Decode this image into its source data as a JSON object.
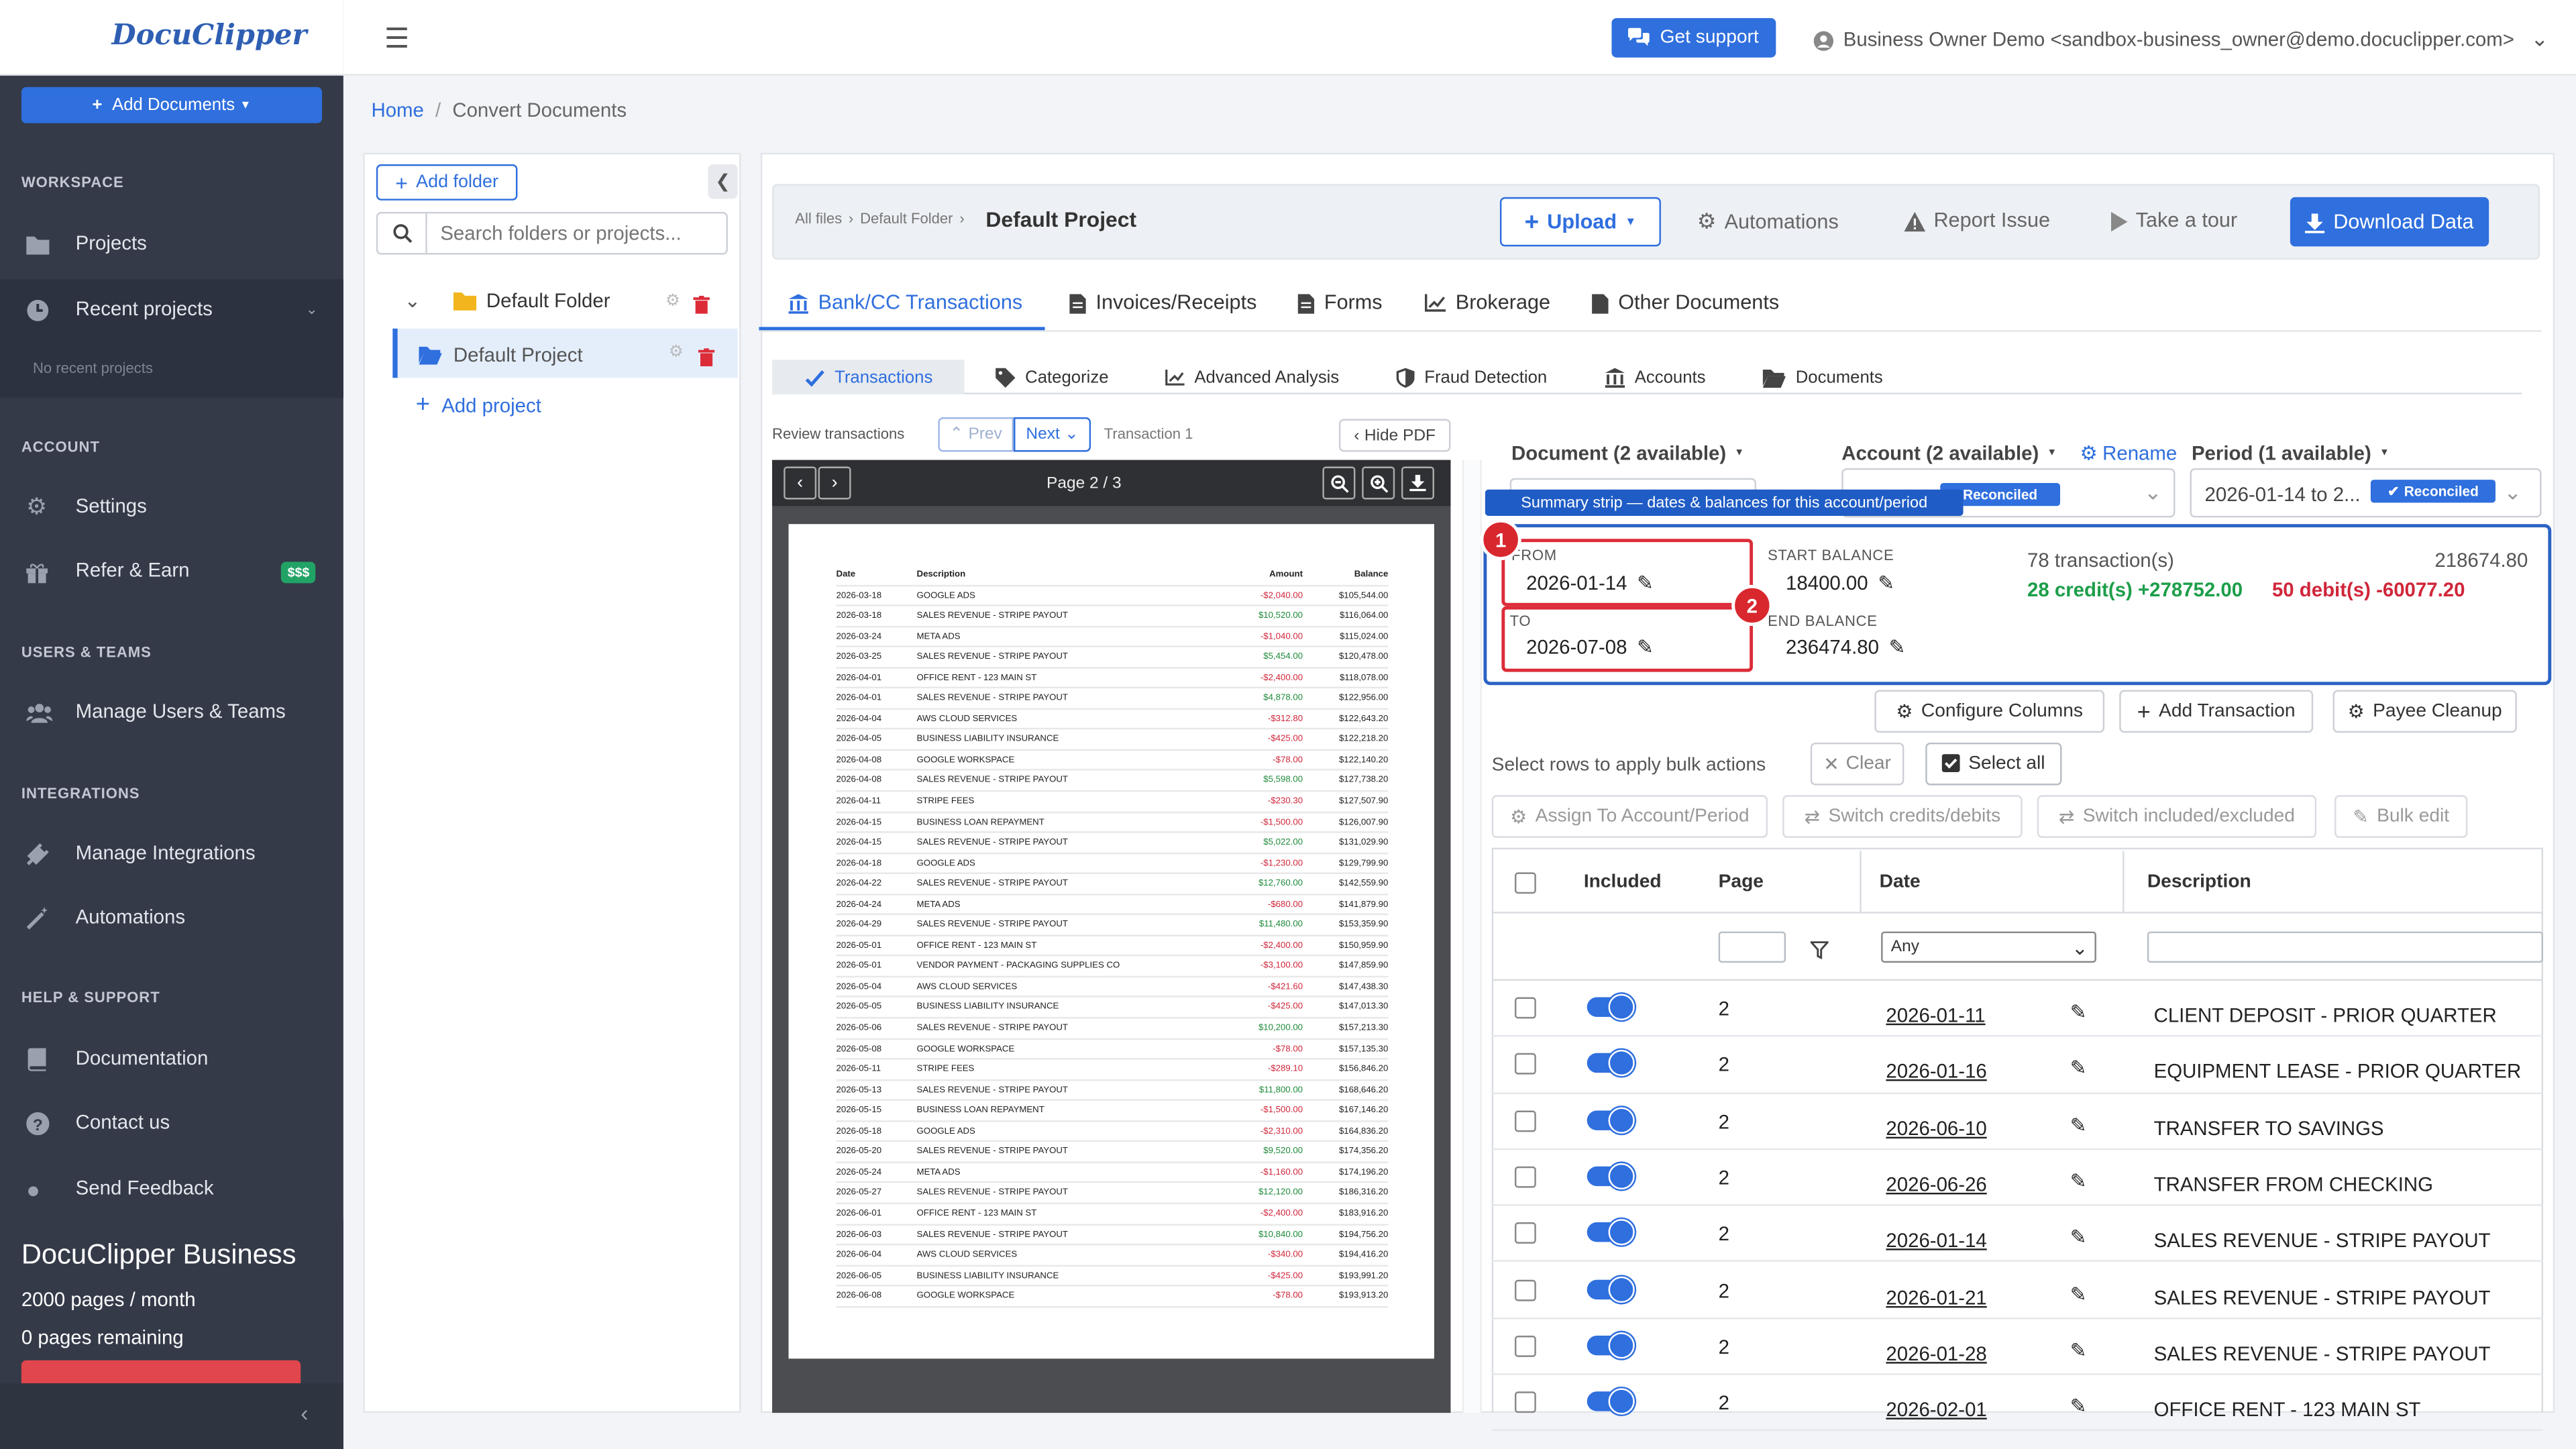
{
  "app": {
    "logo": "DocuClipper"
  },
  "sidebar": {
    "add_documents": "Add Documents",
    "sections": {
      "workspace": "WORKSPACE",
      "account": "ACCOUNT",
      "users_teams": "USERS & TEAMS",
      "integrations": "INTEGRATIONS",
      "help": "HELP & SUPPORT"
    },
    "items": {
      "projects": "Projects",
      "recent_projects": "Recent projects",
      "no_recent": "No recent projects",
      "settings": "Settings",
      "refer": "Refer & Earn",
      "refer_badge": "$$$",
      "manage_users": "Manage Users & Teams",
      "manage_integrations": "Manage Integrations",
      "automations": "Automations",
      "documentation": "Documentation",
      "contact": "Contact us",
      "send_feedback": "Send Feedback"
    },
    "plan": {
      "title": "DocuClipper Business",
      "pages": "2000 pages / month",
      "remaining": "0 pages remaining"
    }
  },
  "topbar": {
    "support": "Get support",
    "user": "Business Owner Demo <sandbox-business_owner@demo.docuclipper.com>"
  },
  "breadcrumb": {
    "home": "Home",
    "sep": "/",
    "current": "Convert Documents"
  },
  "folders": {
    "add_folder": "Add folder",
    "search_placeholder": "Search folders or projects...",
    "default_folder": "Default Folder",
    "default_project": "Default Project",
    "add_project": "Add project"
  },
  "header": {
    "crumb_all": "All files",
    "crumb_folder": "Default Folder",
    "title": "Default Project",
    "upload": "Upload",
    "automations": "Automations",
    "report": "Report Issue",
    "tour": "Take a tour",
    "download": "Download Data"
  },
  "tabs": [
    "Bank/CC Transactions",
    "Invoices/Receipts",
    "Forms",
    "Brokerage",
    "Other Documents"
  ],
  "subtabs": [
    "Transactions",
    "Categorize",
    "Advanced Analysis",
    "Fraud Detection",
    "Accounts",
    "Documents"
  ],
  "review": {
    "label": "Review transactions",
    "prev": "Prev",
    "next": "Next",
    "transaction": "Transaction 1",
    "hide_pdf": "Hide PDF",
    "page": "Page 2 / 3"
  },
  "statement": {
    "headers": [
      "Date",
      "Description",
      "Amount",
      "Balance"
    ],
    "rows": [
      [
        "2026-03-18",
        "GOOGLE ADS",
        "-$2,040.00",
        "$105,544.00"
      ],
      [
        "2026-03-18",
        "SALES REVENUE - STRIPE PAYOUT",
        "$10,520.00",
        "$116,064.00"
      ],
      [
        "2026-03-24",
        "META ADS",
        "-$1,040.00",
        "$115,024.00"
      ],
      [
        "2026-03-25",
        "SALES REVENUE - STRIPE PAYOUT",
        "$5,454.00",
        "$120,478.00"
      ],
      [
        "2026-04-01",
        "OFFICE RENT - 123 MAIN ST",
        "-$2,400.00",
        "$118,078.00"
      ],
      [
        "2026-04-01",
        "SALES REVENUE - STRIPE PAYOUT",
        "$4,878.00",
        "$122,956.00"
      ],
      [
        "2026-04-04",
        "AWS CLOUD SERVICES",
        "-$312.80",
        "$122,643.20"
      ],
      [
        "2026-04-05",
        "BUSINESS LIABILITY INSURANCE",
        "-$425.00",
        "$122,218.20"
      ],
      [
        "2026-04-08",
        "GOOGLE WORKSPACE",
        "-$78.00",
        "$122,140.20"
      ],
      [
        "2026-04-08",
        "SALES REVENUE - STRIPE PAYOUT",
        "$5,598.00",
        "$127,738.20"
      ],
      [
        "2026-04-11",
        "STRIPE FEES",
        "-$230.30",
        "$127,507.90"
      ],
      [
        "2026-04-15",
        "BUSINESS LOAN REPAYMENT",
        "-$1,500.00",
        "$126,007.90"
      ],
      [
        "2026-04-15",
        "SALES REVENUE - STRIPE PAYOUT",
        "$5,022.00",
        "$131,029.90"
      ],
      [
        "2026-04-18",
        "GOOGLE ADS",
        "-$1,230.00",
        "$129,799.90"
      ],
      [
        "2026-04-22",
        "SALES REVENUE - STRIPE PAYOUT",
        "$12,760.00",
        "$142,559.90"
      ],
      [
        "2026-04-24",
        "META ADS",
        "-$680.00",
        "$141,879.90"
      ],
      [
        "2026-04-29",
        "SALES REVENUE - STRIPE PAYOUT",
        "$11,480.00",
        "$153,359.90"
      ],
      [
        "2026-05-01",
        "OFFICE RENT - 123 MAIN ST",
        "-$2,400.00",
        "$150,959.90"
      ],
      [
        "2026-05-01",
        "VENDOR PAYMENT - PACKAGING SUPPLIES CO",
        "-$3,100.00",
        "$147,859.90"
      ],
      [
        "2026-05-04",
        "AWS CLOUD SERVICES",
        "-$421.60",
        "$147,438.30"
      ],
      [
        "2026-05-05",
        "BUSINESS LIABILITY INSURANCE",
        "-$425.00",
        "$147,013.30"
      ],
      [
        "2026-05-06",
        "SALES REVENUE - STRIPE PAYOUT",
        "$10,200.00",
        "$157,213.30"
      ],
      [
        "2026-05-08",
        "GOOGLE WORKSPACE",
        "-$78.00",
        "$157,135.30"
      ],
      [
        "2026-05-11",
        "STRIPE FEES",
        "-$289.10",
        "$156,846.20"
      ],
      [
        "2026-05-13",
        "SALES REVENUE - STRIPE PAYOUT",
        "$11,800.00",
        "$168,646.20"
      ],
      [
        "2026-05-15",
        "BUSINESS LOAN REPAYMENT",
        "-$1,500.00",
        "$167,146.20"
      ],
      [
        "2026-05-18",
        "GOOGLE ADS",
        "-$2,310.00",
        "$164,836.20"
      ],
      [
        "2026-05-20",
        "SALES REVENUE - STRIPE PAYOUT",
        "$9,520.00",
        "$174,356.20"
      ],
      [
        "2026-05-24",
        "META ADS",
        "-$1,160.00",
        "$174,196.20"
      ],
      [
        "2026-05-27",
        "SALES REVENUE - STRIPE PAYOUT",
        "$12,120.00",
        "$186,316.20"
      ],
      [
        "2026-06-01",
        "OFFICE RENT - 123 MAIN ST",
        "-$2,400.00",
        "$183,916.20"
      ],
      [
        "2026-06-03",
        "SALES REVENUE - STRIPE PAYOUT",
        "$10,840.00",
        "$194,756.20"
      ],
      [
        "2026-06-04",
        "AWS CLOUD SERVICES",
        "-$340.00",
        "$194,416.20"
      ],
      [
        "2026-06-05",
        "BUSINESS LIABILITY INSURANCE",
        "-$425.00",
        "$193,991.20"
      ],
      [
        "2026-06-08",
        "GOOGLE WORKSPACE",
        "-$78.00",
        "$193,913.20"
      ]
    ]
  },
  "selectors": {
    "document": "Document (2 available)",
    "account": "Account (2 available)",
    "rename": "Rename",
    "period": "Period (1 available)",
    "period_value": "2026-01-14 to 2...",
    "reconciled": "Reconciled"
  },
  "summary": {
    "tooltip": "Summary strip — dates & balances for this account/period",
    "from_label": "FROM",
    "from_value": "2026-01-14",
    "to_label": "TO",
    "to_value": "2026-07-08",
    "start_label": "START BALANCE",
    "start_value": "18400.00",
    "end_label": "END BALANCE",
    "end_value": "236474.80",
    "transactions": "78 transaction(s)",
    "total": "218674.80",
    "credits": "28 credit(s) +278752.00",
    "debits": "50 debit(s) -60077.20",
    "badge1": "1",
    "badge2": "2"
  },
  "actions": {
    "configure": "Configure Columns",
    "add_txn": "Add Transaction",
    "payee": "Payee Cleanup",
    "bulk_hint": "Select rows to apply bulk actions",
    "clear": "Clear",
    "select_all": "Select all",
    "assign": "Assign To Account/Period",
    "switch_cd": "Switch credits/debits",
    "switch_ie": "Switch included/excluded",
    "bulk_edit": "Bulk edit"
  },
  "table": {
    "headers": {
      "included": "Included",
      "page": "Page",
      "date": "Date",
      "description": "Description"
    },
    "date_filter": "Any",
    "rows": [
      {
        "page": "2",
        "date": "2026-01-11",
        "desc": "CLIENT DEPOSIT - PRIOR QUARTER"
      },
      {
        "page": "2",
        "date": "2026-01-16",
        "desc": "EQUIPMENT LEASE - PRIOR QUARTER"
      },
      {
        "page": "2",
        "date": "2026-06-10",
        "desc": "TRANSFER TO SAVINGS"
      },
      {
        "page": "2",
        "date": "2026-06-26",
        "desc": "TRANSFER FROM CHECKING"
      },
      {
        "page": "2",
        "date": "2026-01-14",
        "desc": "SALES REVENUE - STRIPE PAYOUT"
      },
      {
        "page": "2",
        "date": "2026-01-21",
        "desc": "SALES REVENUE - STRIPE PAYOUT"
      },
      {
        "page": "2",
        "date": "2026-01-28",
        "desc": "SALES REVENUE - STRIPE PAYOUT"
      },
      {
        "page": "2",
        "date": "2026-02-01",
        "desc": "OFFICE RENT - 123 MAIN ST"
      }
    ]
  },
  "colors": {
    "primary": "#2f6fde",
    "sidebar": "#343a48",
    "danger": "#dc2c38",
    "credit": "#1d9e4a",
    "debit": "#d0263a"
  }
}
